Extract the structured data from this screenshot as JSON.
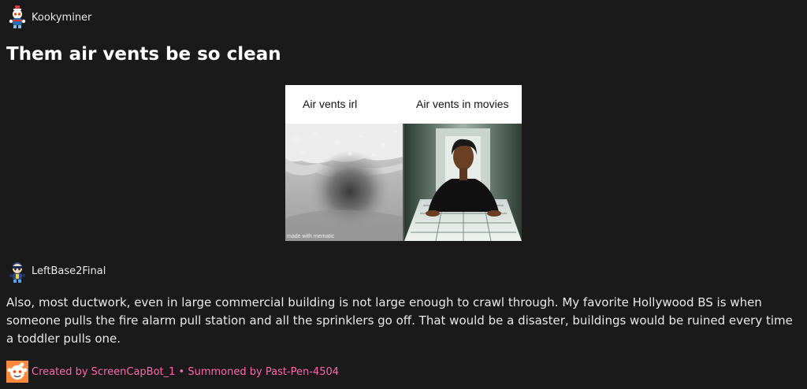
{
  "post": {
    "author": "Kookyminer",
    "title": "Them air vents be so clean"
  },
  "meme": {
    "left_caption": "Air vents irl",
    "right_caption": "Air vents in movies",
    "watermark": "made with mematic"
  },
  "comment": {
    "author": "LeftBase2Final",
    "body": "Also, most ductwork, even in large commercial building is not large enough to crawl through. My favorite Hollywood BS is when someone pulls the fire alarm pull station and all the sprinklers go off. That would be a disaster, buildings would be ruined every time a toddler pulls one."
  },
  "footer": {
    "created_label": "Created by",
    "bot_name": "ScreenCapBot_1",
    "separator": "•",
    "summoned_label": "Summoned by",
    "summoner": "Past-Pen-4504"
  },
  "colors": {
    "background": "#1a1a1b",
    "text": "#e8e8e8",
    "footer_accent": "#ff66ac"
  }
}
